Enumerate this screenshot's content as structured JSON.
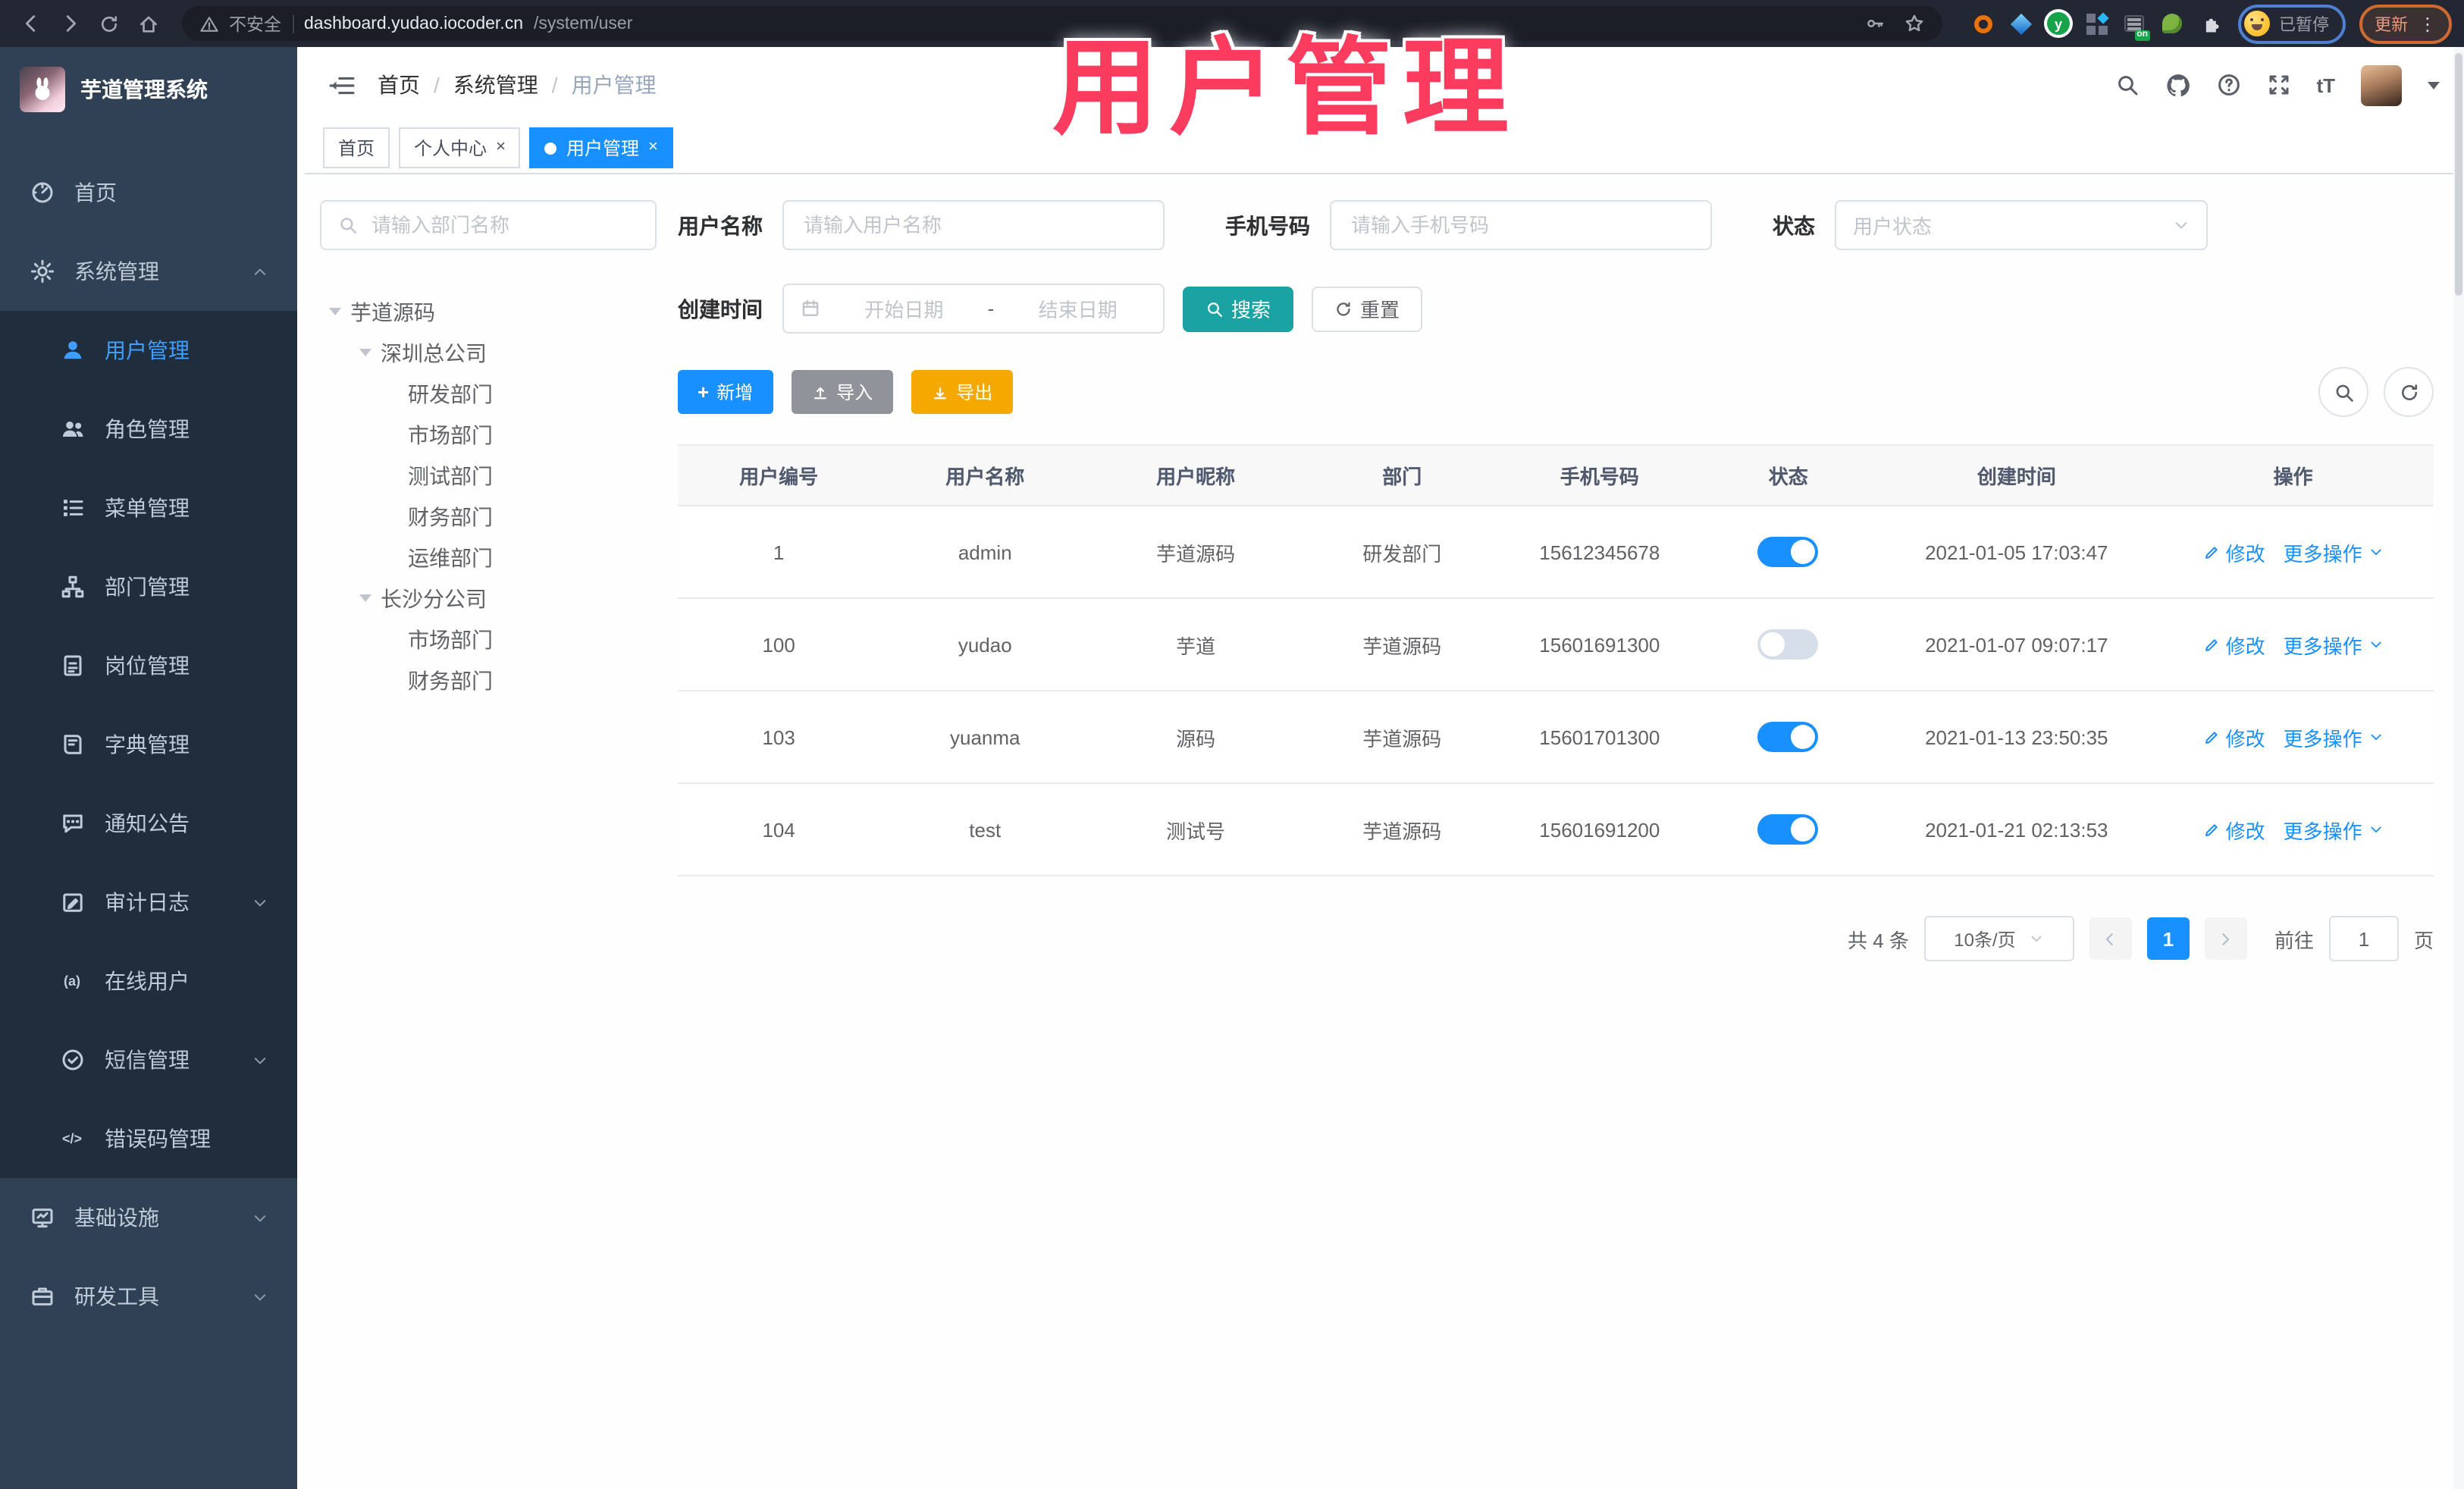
{
  "overlay": {
    "text": "用户管理",
    "color": "#fb3c5e"
  },
  "browser": {
    "security_label": "不安全",
    "url_host": "dashboard.yudao.iocoder.cn",
    "url_path": "/system/user",
    "profile_label": "已暂停",
    "update_label": "更新"
  },
  "header": {
    "breadcrumb": [
      "首页",
      "系统管理",
      "用户管理"
    ],
    "breadcrumb_separator": "/",
    "font_icon_glyph": "tT"
  },
  "tabs": [
    {
      "label": "首页",
      "closable": false,
      "active": false
    },
    {
      "label": "个人中心",
      "closable": true,
      "active": false
    },
    {
      "label": "用户管理",
      "closable": true,
      "active": true
    }
  ],
  "sidebar": {
    "app_title": "芋道管理系统",
    "icon_glyphs": {
      "online": "(a)",
      "code": "</>"
    },
    "items": [
      {
        "label": "首页",
        "icon": "dashboard-icon"
      },
      {
        "label": "系统管理",
        "icon": "gear-icon",
        "chevron": "up",
        "expanded": true
      },
      {
        "label": "用户管理",
        "icon": "user-icon",
        "active": true,
        "sub": true
      },
      {
        "label": "角色管理",
        "icon": "users-icon",
        "sub": true
      },
      {
        "label": "菜单管理",
        "icon": "menu-list-icon",
        "sub": true
      },
      {
        "label": "部门管理",
        "icon": "org-tree-icon",
        "sub": true
      },
      {
        "label": "岗位管理",
        "icon": "id-badge-icon",
        "sub": true
      },
      {
        "label": "字典管理",
        "icon": "dictionary-icon",
        "sub": true
      },
      {
        "label": "通知公告",
        "icon": "announcement-icon",
        "sub": true
      },
      {
        "label": "审计日志",
        "icon": "audit-log-icon",
        "chevron": "down",
        "sub": true
      },
      {
        "label": "在线用户",
        "icon": "online-user-icon",
        "sub": true
      },
      {
        "label": "短信管理",
        "icon": "sms-icon",
        "chevron": "down",
        "sub": true
      },
      {
        "label": "错误码管理",
        "icon": "error-code-icon",
        "sub": true
      },
      {
        "label": "基础设施",
        "icon": "infrastructure-icon",
        "chevron": "down"
      },
      {
        "label": "研发工具",
        "icon": "dev-tools-icon",
        "chevron": "down"
      }
    ]
  },
  "dept_tree": {
    "search_placeholder": "请输入部门名称",
    "nodes": [
      {
        "label": "芋道源码",
        "level": 0,
        "expanded": true
      },
      {
        "label": "深圳总公司",
        "level": 1,
        "expanded": true
      },
      {
        "label": "研发部门",
        "level": 2
      },
      {
        "label": "市场部门",
        "level": 2
      },
      {
        "label": "测试部门",
        "level": 2
      },
      {
        "label": "财务部门",
        "level": 2
      },
      {
        "label": "运维部门",
        "level": 2
      },
      {
        "label": "长沙分公司",
        "level": 1,
        "expanded": true
      },
      {
        "label": "市场部门",
        "level": 2
      },
      {
        "label": "财务部门",
        "level": 2
      }
    ]
  },
  "filters": {
    "username_label": "用户名称",
    "username_placeholder": "请输入用户名称",
    "mobile_label": "手机号码",
    "mobile_placeholder": "请输入手机号码",
    "status_label": "状态",
    "status_placeholder": "用户状态",
    "create_time_label": "创建时间",
    "date_start_placeholder": "开始日期",
    "date_separator": "-",
    "date_end_placeholder": "结束日期",
    "search_label": "搜索",
    "reset_label": "重置"
  },
  "toolbar": {
    "add_label": "新增",
    "import_label": "导入",
    "export_label": "导出"
  },
  "table": {
    "columns": [
      "用户编号",
      "用户名称",
      "用户昵称",
      "部门",
      "手机号码",
      "状态",
      "创建时间",
      "操作"
    ],
    "rows": [
      {
        "id": "1",
        "username": "admin",
        "nickname": "芋道源码",
        "dept": "研发部门",
        "mobile": "15612345678",
        "status": "on",
        "create_time": "2021-01-05 17:03:47"
      },
      {
        "id": "100",
        "username": "yudao",
        "nickname": "芋道",
        "dept": "芋道源码",
        "mobile": "15601691300",
        "status": "off",
        "create_time": "2021-01-07 09:07:17"
      },
      {
        "id": "103",
        "username": "yuanma",
        "nickname": "源码",
        "dept": "芋道源码",
        "mobile": "15601701300",
        "status": "on",
        "create_time": "2021-01-13 23:50:35"
      },
      {
        "id": "104",
        "username": "test",
        "nickname": "测试号",
        "dept": "芋道源码",
        "mobile": "15601691200",
        "status": "on",
        "create_time": "2021-01-21 02:13:53"
      }
    ],
    "actions": {
      "modify": "修改",
      "more": "更多操作"
    }
  },
  "pagination": {
    "total": "共 4 条",
    "page_size": "10条/页",
    "current_page": "1",
    "goto_label": "前往",
    "goto_value": "1",
    "unit_label": "页"
  },
  "colors": {
    "accent_blue": "#1890ff",
    "sidebar_bg": "#304156",
    "submenu_bg": "#1f2d3d",
    "search_button": "#1ba3a3",
    "import_button": "#909399",
    "export_button": "#f5a800",
    "overlay_pink": "#fb3c5e"
  }
}
